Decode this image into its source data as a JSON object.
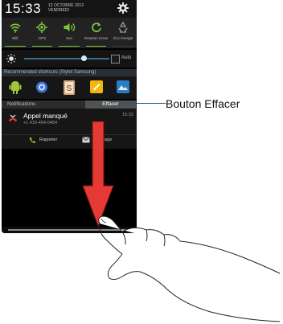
{
  "statusbar": {
    "time": "15:33",
    "date_line1": "12 OCTOBRE 2012",
    "date_line2": "VENDREDI"
  },
  "toggles": [
    {
      "label": "Wifi",
      "icon": "wifi-icon",
      "on": true
    },
    {
      "label": "GPS",
      "icon": "gps-icon",
      "on": true
    },
    {
      "label": "Son",
      "icon": "sound-icon",
      "on": true
    },
    {
      "label": "Rotation écran",
      "icon": "rotation-icon",
      "on": true
    },
    {
      "label": "Éco énergie",
      "icon": "recycle-icon",
      "on": false
    }
  ],
  "brightness": {
    "level": 0.7,
    "auto_label": "Auto",
    "auto_checked": false
  },
  "shortcuts": {
    "header": "Recommended shortcuts (Stylet Samsung)",
    "items": [
      "android-app-icon",
      "settings-app-icon",
      "s-note-icon",
      "memo-icon",
      "photo-app-icon"
    ]
  },
  "notifications": {
    "header": "Notifications",
    "clear_button": "Effacer",
    "items": [
      {
        "title": "Appel manqué",
        "number": "+1 416-464-0464",
        "time": "15:32",
        "actions": {
          "callback": "Rappeler",
          "message": "Message"
        }
      }
    ]
  },
  "callout": {
    "label": "Bouton Effacer"
  },
  "colors": {
    "accent_green": "#7ec63c",
    "arrow_red": "#e53935",
    "callout_blue": "#2a4a9a"
  }
}
